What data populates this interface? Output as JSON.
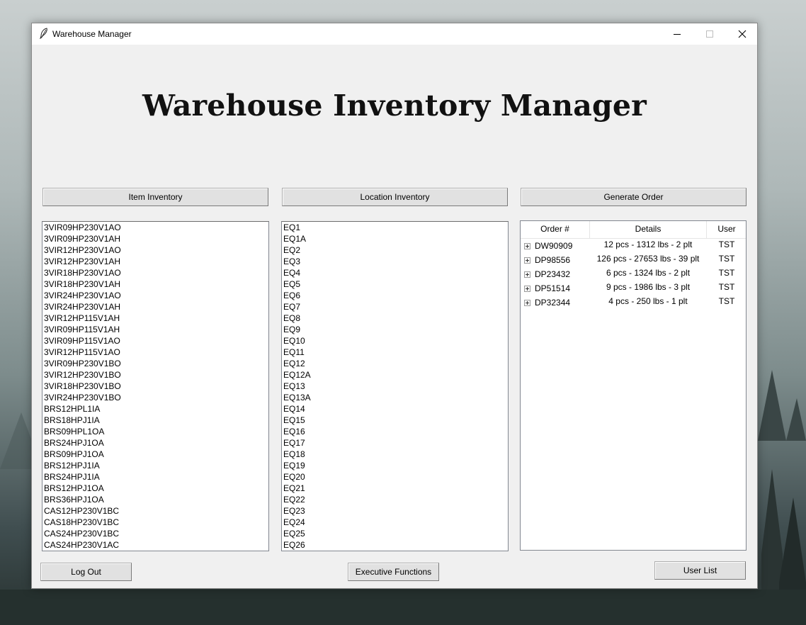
{
  "window": {
    "title": "Warehouse Manager"
  },
  "header": {
    "title": "Warehouse Inventory Manager"
  },
  "buttons": {
    "item_inventory": "Item Inventory",
    "location_inventory": "Location Inventory",
    "generate_order": "Generate Order",
    "log_out": "Log Out",
    "executive_functions": "Executive Functions",
    "user_list": "User List"
  },
  "items": [
    "3VIR09HP230V1AO",
    "3VIR09HP230V1AH",
    "3VIR12HP230V1AO",
    "3VIR12HP230V1AH",
    "3VIR18HP230V1AO",
    "3VIR18HP230V1AH",
    "3VIR24HP230V1AO",
    "3VIR24HP230V1AH",
    "3VIR12HP115V1AH",
    "3VIR09HP115V1AH",
    "3VIR09HP115V1AO",
    "3VIR12HP115V1AO",
    "3VIR09HP230V1BO",
    "3VIR12HP230V1BO",
    "3VIR18HP230V1BO",
    "3VIR24HP230V1BO",
    "BRS12HPL1IA",
    "BRS18HPJ1IA",
    "BRS09HPL1OA",
    "BRS24HPJ1OA",
    "BRS09HPJ1OA",
    "BRS12HPJ1IA",
    "BRS24HPJ1IA",
    "BRS12HPJ1OA",
    "BRS36HPJ1OA",
    "CAS12HP230V1BC",
    "CAS18HP230V1BC",
    "CAS24HP230V1BC",
    "CAS24HP230V1AC"
  ],
  "locations": [
    "EQ1",
    "EQ1A",
    "EQ2",
    "EQ3",
    "EQ4",
    "EQ5",
    "EQ6",
    "EQ7",
    "EQ8",
    "EQ9",
    "EQ10",
    "EQ11",
    "EQ12",
    "EQ12A",
    "EQ13",
    "EQ13A",
    "EQ14",
    "EQ15",
    "EQ16",
    "EQ17",
    "EQ18",
    "EQ19",
    "EQ20",
    "EQ21",
    "EQ22",
    "EQ23",
    "EQ24",
    "EQ25",
    "EQ26"
  ],
  "orders": {
    "columns": {
      "order": "Order #",
      "details": "Details",
      "user": "User"
    },
    "rows": [
      {
        "order": "DW90909",
        "details": "12 pcs - 1312 lbs - 2 plt",
        "user": "TST"
      },
      {
        "order": "DP98556",
        "details": "126 pcs - 27653 lbs - 39 plt",
        "user": "TST"
      },
      {
        "order": "DP23432",
        "details": "6 pcs - 1324 lbs - 2 plt",
        "user": "TST"
      },
      {
        "order": "DP51514",
        "details": "9 pcs - 1986 lbs - 3 plt",
        "user": "TST"
      },
      {
        "order": "DP32344",
        "details": "4 pcs - 250 lbs - 1 plt",
        "user": "TST"
      }
    ]
  }
}
